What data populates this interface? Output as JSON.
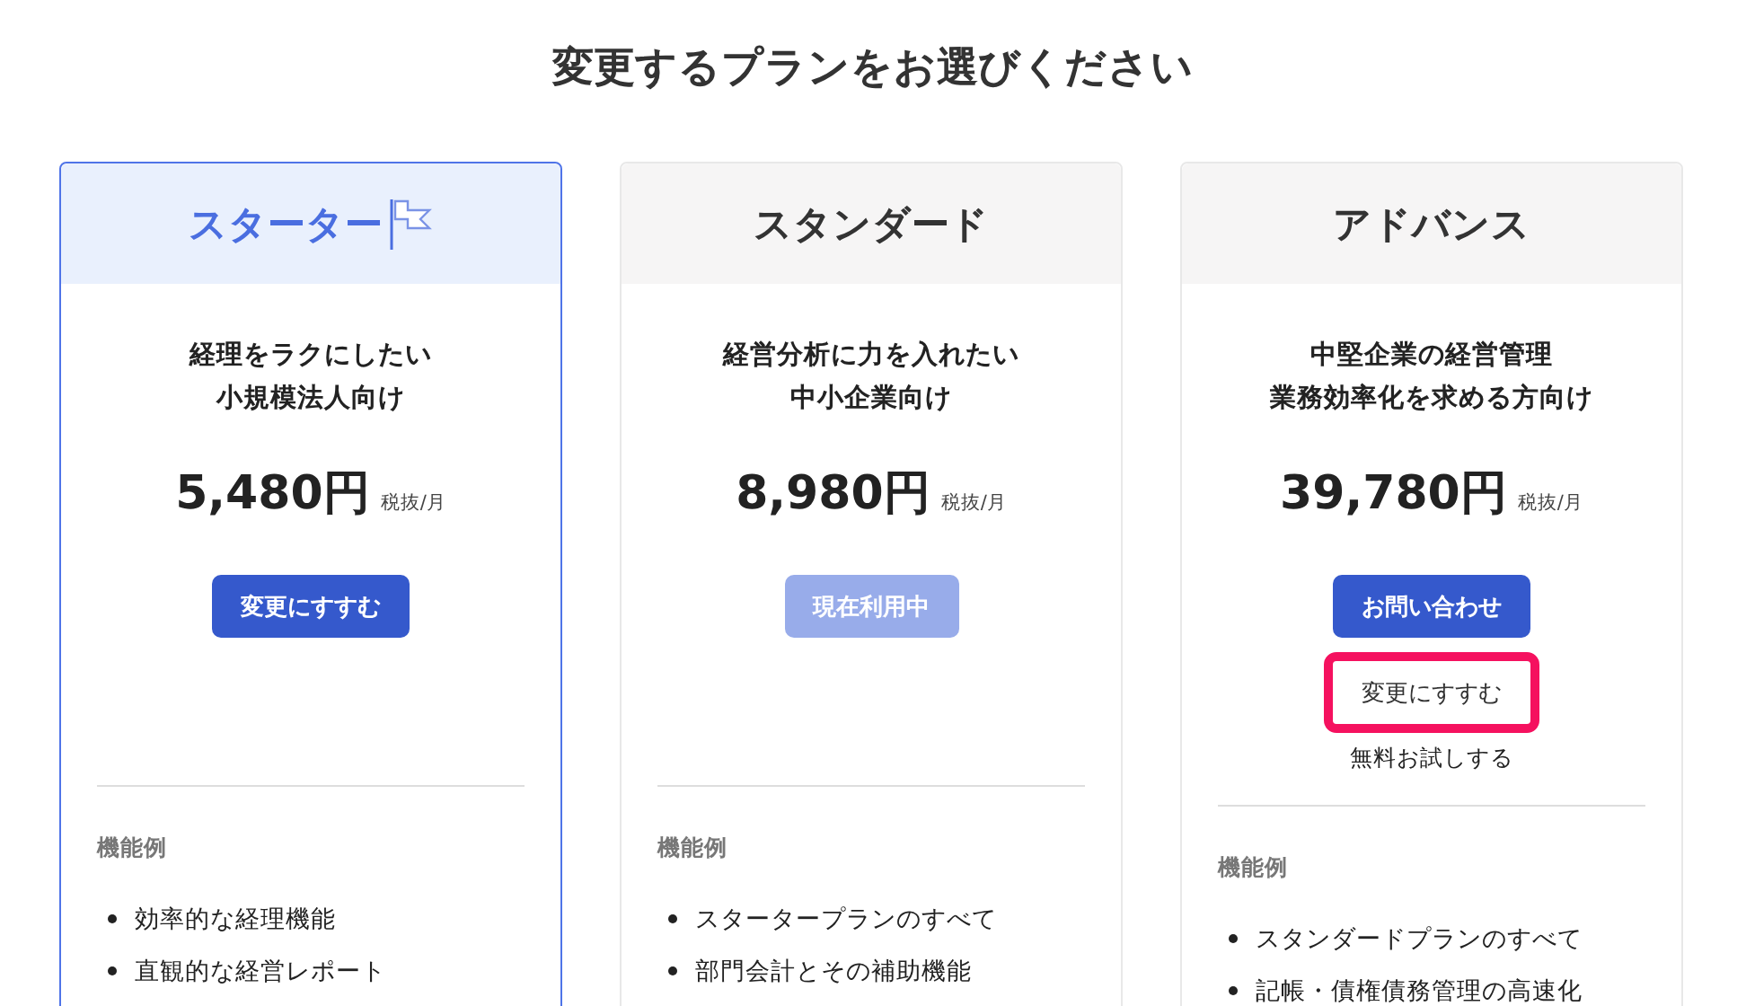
{
  "title": "変更するプランをお選びください",
  "plans": [
    {
      "name": "スターター",
      "selected": true,
      "description": [
        "経理をラクにしたい",
        "小規模法人向け"
      ],
      "price": "5,480円",
      "price_unit": "税抜/月",
      "buttons": [
        {
          "label": "変更にすすむ",
          "kind": "primary",
          "highlighted": false
        }
      ],
      "features_heading": "機能例",
      "features": [
        "効率的な経理機能",
        "直観的な経営レポート"
      ]
    },
    {
      "name": "スタンダード",
      "selected": false,
      "description": [
        "経営分析に力を入れたい",
        "中小企業向け"
      ],
      "price": "8,980円",
      "price_unit": "税抜/月",
      "buttons": [
        {
          "label": "現在利用中",
          "kind": "current",
          "highlighted": false
        }
      ],
      "features_heading": "機能例",
      "features": [
        "スタータープランのすべて",
        "部門会計とその補助機能"
      ]
    },
    {
      "name": "アドバンス",
      "selected": false,
      "description": [
        "中堅企業の経営管理",
        "業務効率化を求める方向け"
      ],
      "price": "39,780円",
      "price_unit": "税抜/月",
      "buttons": [
        {
          "label": "お問い合わせ",
          "kind": "primary",
          "highlighted": false
        },
        {
          "label": "変更にすすむ",
          "kind": "secondary",
          "highlighted": true
        }
      ],
      "trial_link": "無料お試しする",
      "features_heading": "機能例",
      "features": [
        "スタンダードプランのすべて",
        "記帳・債権債務管理の高速化"
      ]
    }
  ]
}
